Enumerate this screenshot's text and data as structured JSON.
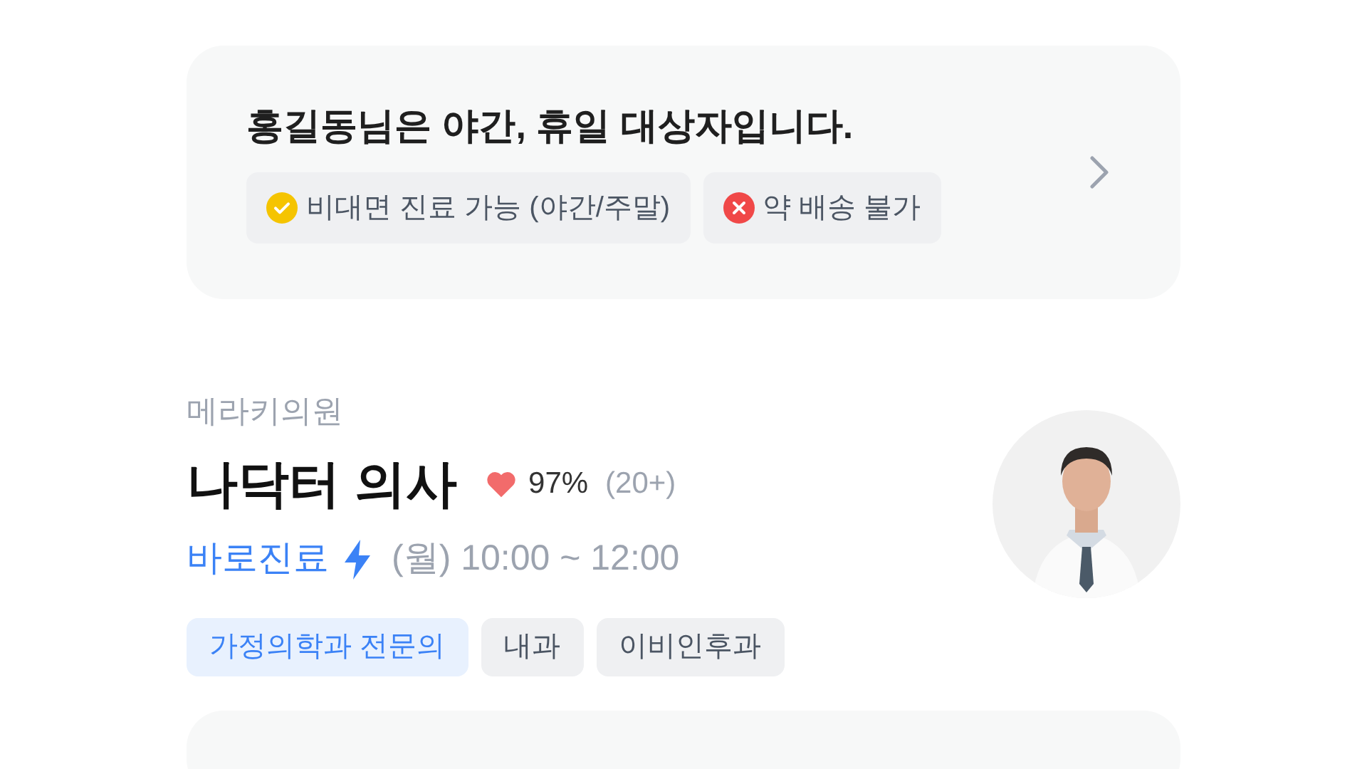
{
  "notice": {
    "title": "홍길동님은 야간, 휴일 대상자입니다.",
    "badges": [
      {
        "kind": "available",
        "label": "비대면 진료 가능 (야간/주말)"
      },
      {
        "kind": "unavailable",
        "label": "약 배송 불가"
      }
    ]
  },
  "doctor": {
    "clinic": "메라키의원",
    "name": "나닥터 의사",
    "rating": "97%",
    "reviews": "(20+)",
    "instant": "바로진료",
    "hours": "(월) 10:00 ~ 12:00",
    "tags": [
      {
        "kind": "primary",
        "label": "가정의학과 전문의"
      },
      {
        "kind": "default",
        "label": "내과"
      },
      {
        "kind": "default",
        "label": "이비인후과"
      }
    ]
  }
}
